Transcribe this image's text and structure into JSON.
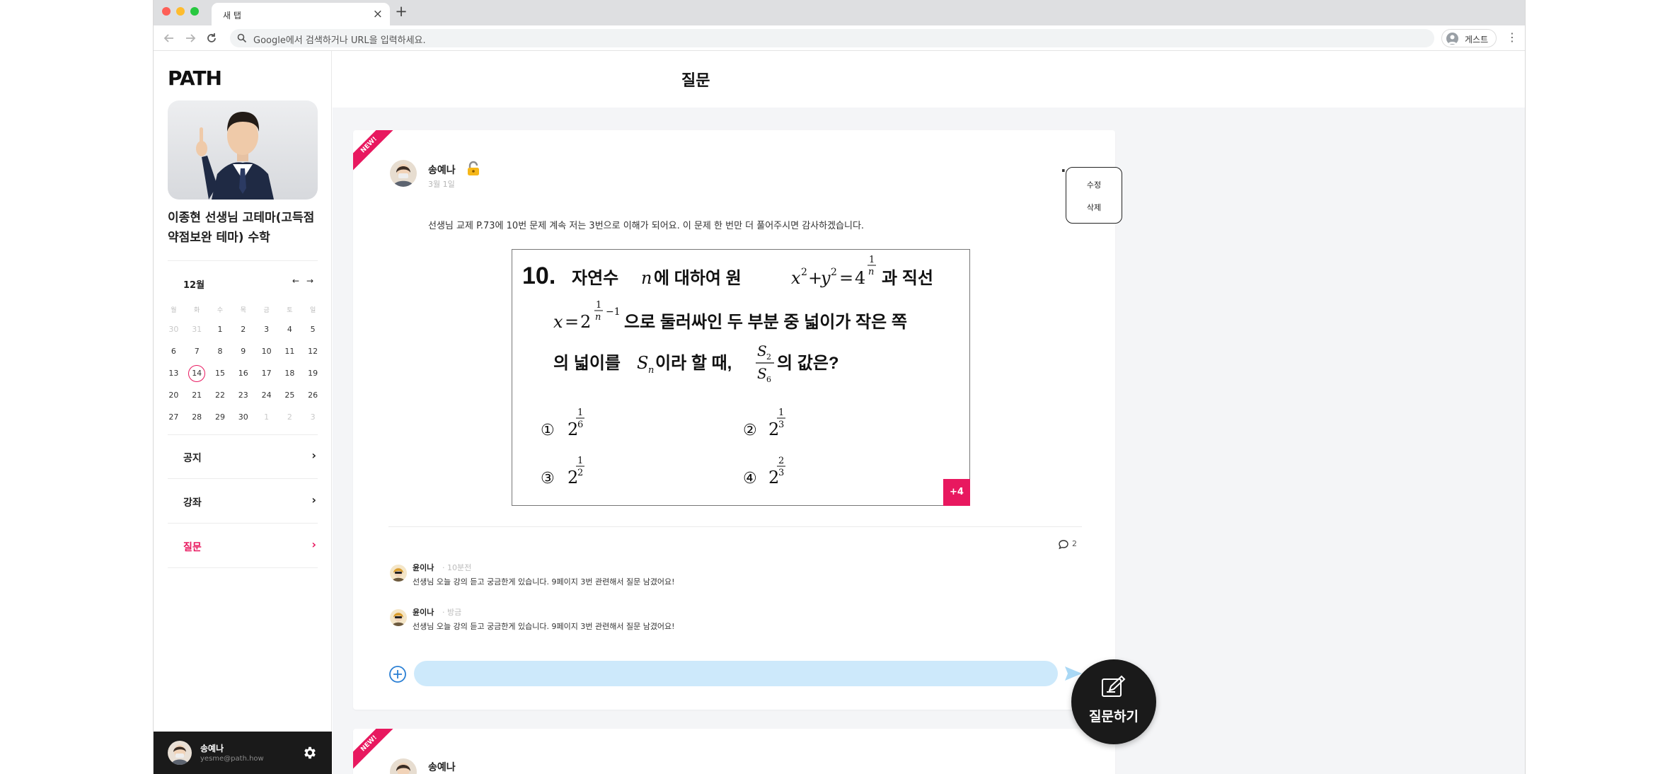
{
  "browser": {
    "tab_title": "새 탭",
    "tab_close": "×",
    "new_tab": "+",
    "address_placeholder": "Google에서 검색하거나 URL을 입력하세요.",
    "profile_label": "게스트",
    "menu_glyph": "⋮"
  },
  "sidebar": {
    "logo": "PATH",
    "course_title": "이종현 선생님 고테마(고득점 약점보완 테마) 수학",
    "calendar": {
      "month": "12월",
      "prev": "←",
      "next": "→",
      "weekdays": [
        "월",
        "화",
        "수",
        "목",
        "금",
        "토",
        "일"
      ],
      "weeks": [
        [
          "30",
          "31",
          "1",
          "2",
          "3",
          "4",
          "5"
        ],
        [
          "6",
          "7",
          "8",
          "9",
          "10",
          "11",
          "12"
        ],
        [
          "13",
          "14",
          "15",
          "16",
          "17",
          "18",
          "19"
        ],
        [
          "20",
          "21",
          "22",
          "23",
          "24",
          "25",
          "26"
        ],
        [
          "27",
          "28",
          "29",
          "30",
          "1",
          "2",
          "3"
        ]
      ],
      "today": "14"
    },
    "menu": [
      {
        "label": "공지",
        "arrow": "›"
      },
      {
        "label": "강좌",
        "arrow": "›"
      },
      {
        "label": "질문",
        "arrow": "›"
      }
    ],
    "user": {
      "name": "송예나",
      "email": "yesme@path.how"
    }
  },
  "page": {
    "title": "질문"
  },
  "post": {
    "badge": "NEW!",
    "author": "송예나",
    "date": "3월 1일",
    "more": "···",
    "body": "선생님 교제 P.73에 10번 문제 계속 저는 3번으로 이해가 되어요. 이 문제 한 번만 더 풀어주시면 감사하겠습니다.",
    "image_more": "+4",
    "comment_count": "2",
    "problem": {
      "number": "10.",
      "line1_a": "자연수",
      "line1_b": "에  대하여  원",
      "line1_c": "과  직선",
      "line2": "으로  둘러싸인  두  부분  중  넓이가  작은  쪽",
      "line3_a": "의  넓이를",
      "line3_b": "이라  할  때,",
      "line3_c": "의  값은?",
      "choice_marks": [
        "①",
        "②",
        "③",
        "④"
      ],
      "exp_1": "1",
      "exp_6": "6",
      "exp_3": "3",
      "exp_2": "2",
      "var_n": "n",
      "var_x": "x",
      "var_y": "y",
      "var_S": "S",
      "eq": "=",
      "plus": "+",
      "minus": "−1",
      "base_2": "2",
      "base_4": "4",
      "sub_n": "n",
      "sub_2": "2",
      "sub_6": "6"
    },
    "comments": [
      {
        "name": "윤이나",
        "time": "· 10분전",
        "text": "선생님 오늘 강의 듣고 궁금한게 있습니다. 9페이지 3번 관련해서 질문 남겼어요!"
      },
      {
        "name": "윤이나",
        "time": "· 방금",
        "text": "선생님 오늘 강의 듣고 궁금한게 있습니다. 9페이지 3번 관련해서 질문 남겼어요!"
      }
    ]
  },
  "post2": {
    "badge": "NEW!",
    "author": "송예나"
  },
  "dropdown": {
    "edit": "수정",
    "delete": "삭제"
  },
  "fab": {
    "label": "질문하기"
  },
  "colors": {
    "accent": "#e8185f",
    "dark": "#1a1a1a",
    "input_bg": "#cde9fb",
    "send": "#a9d8f5"
  }
}
